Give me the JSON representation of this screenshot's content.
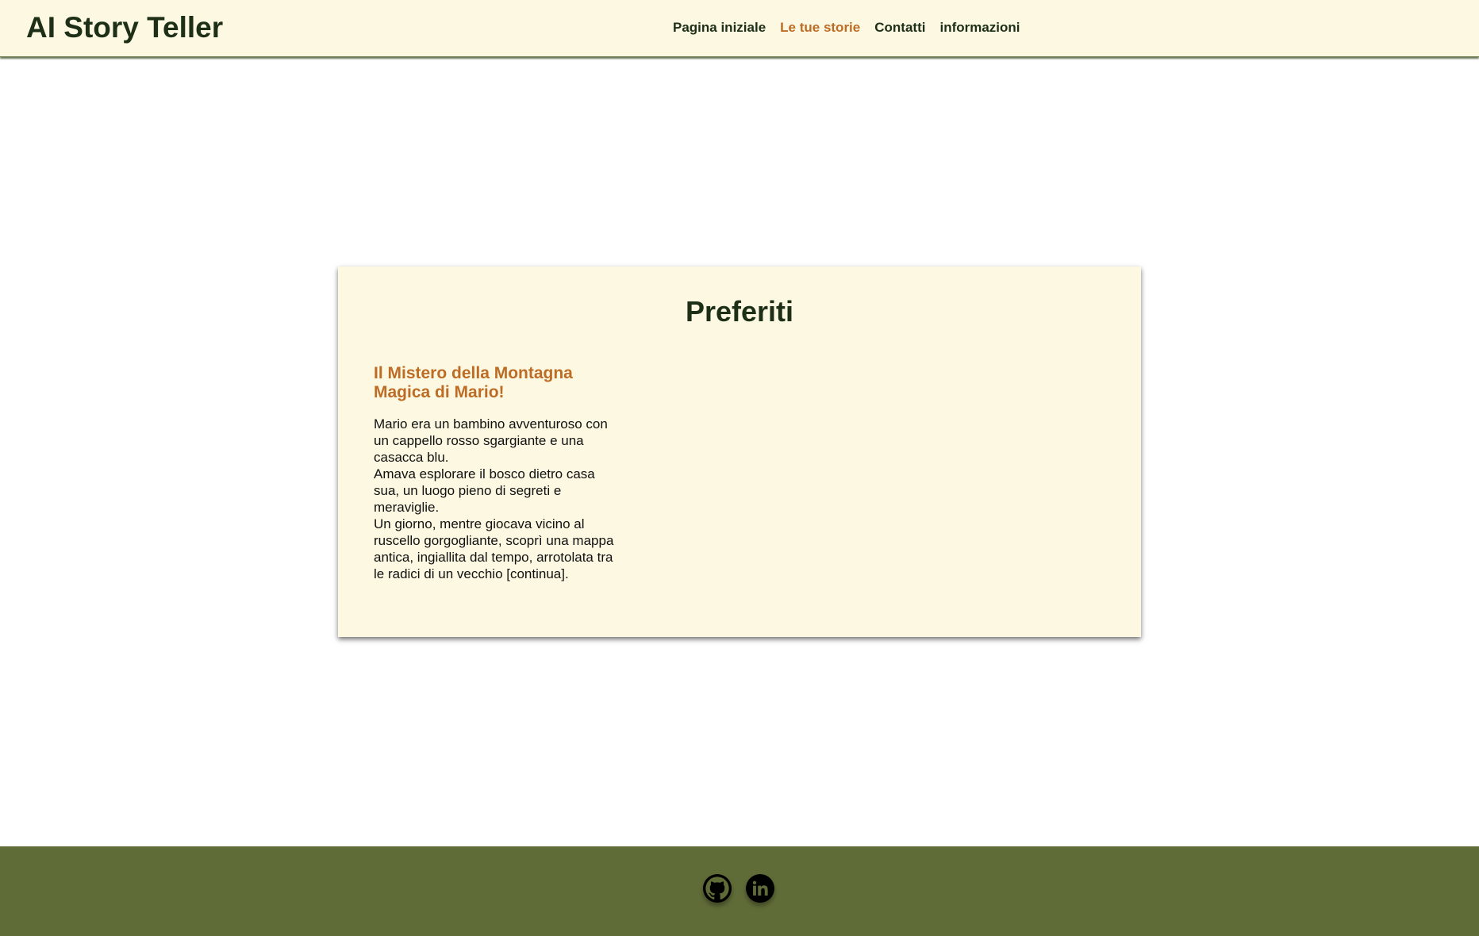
{
  "header": {
    "brand": "AI Story Teller",
    "nav": [
      {
        "label": "Pagina iniziale",
        "active": false
      },
      {
        "label": "Le tue storie",
        "active": true
      },
      {
        "label": "Contatti",
        "active": false
      },
      {
        "label": "informazioni",
        "active": false
      }
    ]
  },
  "main": {
    "title": "Preferiti",
    "story": {
      "title": "Il Mistero della Montagna Magica di Mario!",
      "paragraphs": [
        "Mario era un bambino avventuroso con un cappello rosso sgargiante e una casacca blu.",
        "Amava esplorare il bosco dietro casa sua, un luogo pieno di segreti e meraviglie.",
        "Un giorno, mentre giocava vicino al ruscello gorgogliante, scoprì una mappa antica, ingiallita dal tempo, arrotolata tra le radici di un vecchio [continua]."
      ]
    }
  },
  "footer": {
    "icons": [
      "github-icon",
      "linkedin-icon"
    ]
  },
  "colors": {
    "header_bg": "#fdf8e1",
    "accent": "#bc6c25",
    "text_dark": "#1e2f17",
    "footer_bg": "#606c38"
  }
}
